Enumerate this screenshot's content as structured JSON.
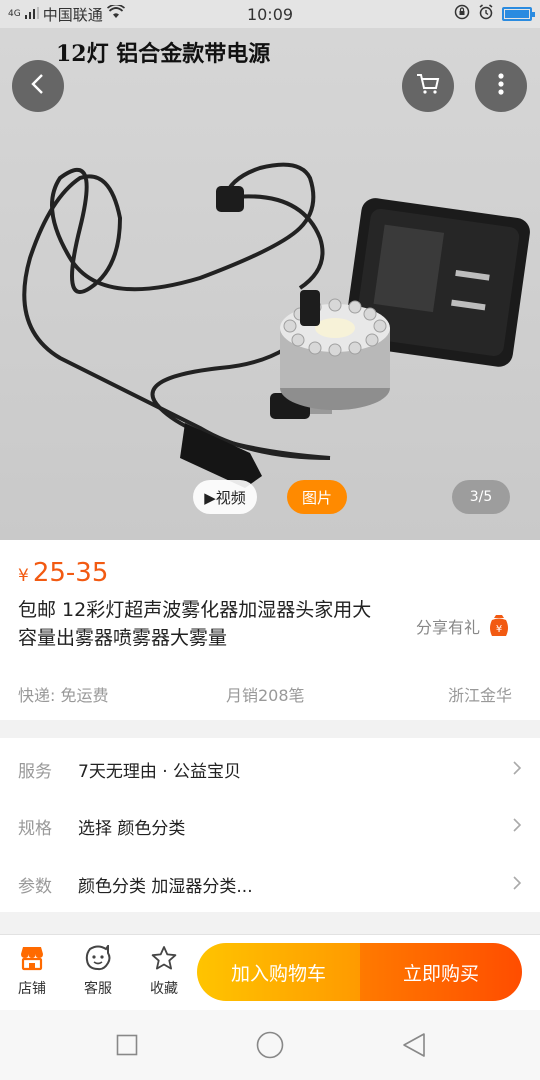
{
  "status": {
    "network": "4G",
    "carrier": "中国联通",
    "time": "10:09",
    "battery_percent": 100,
    "accent": "#2a8be0"
  },
  "hero": {
    "image_title": "12灯 铝合金款带电源",
    "video_label": "▶视频",
    "image_label": "图片",
    "counter": "3/5"
  },
  "product": {
    "currency": "¥",
    "price": "25-35",
    "title": "包邮 12彩灯超声波雾化器加湿器头家用大容量出雾器喷雾器大雾量",
    "share_label": "分享有礼",
    "shipping": "快递: 免运费",
    "monthly_sales": "月销208笔",
    "location": "浙江金华"
  },
  "services": [
    {
      "key": "服务",
      "value": "7天无理由 · 公益宝贝"
    },
    {
      "key": "规格",
      "value": "选择 颜色分类"
    },
    {
      "key": "参数",
      "value": "颜色分类 加湿器分类..."
    }
  ],
  "bottom": {
    "store": "店铺",
    "service": "客服",
    "favorite": "收藏",
    "add_cart": "加入购物车",
    "buy_now": "立即购买"
  },
  "colors": {
    "price": "#f25a12",
    "orange": "#ff8a00",
    "cart_gradient": [
      "#ffc400",
      "#ff9a00"
    ],
    "buy_gradient": [
      "#ff7a00",
      "#ff4d00"
    ]
  }
}
